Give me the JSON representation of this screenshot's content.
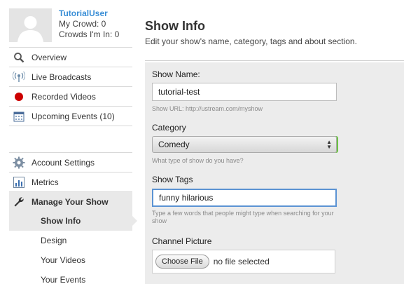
{
  "profile": {
    "username": "TutorialUser",
    "my_crowd": "My Crowd: 0",
    "crowds_in": "Crowds I'm In: 0"
  },
  "nav_top": [
    {
      "label": "Overview",
      "icon": "magnifier-icon"
    },
    {
      "label": "Live Broadcasts",
      "icon": "broadcast-icon"
    },
    {
      "label": "Recorded Videos",
      "icon": "record-icon"
    },
    {
      "label": "Upcoming Events (10)",
      "icon": "calendar-icon"
    }
  ],
  "nav_bottom": [
    {
      "label": "Account Settings",
      "icon": "gear-icon"
    },
    {
      "label": "Metrics",
      "icon": "bar-chart-icon"
    },
    {
      "label": "Manage Your Show",
      "icon": "wrench-icon"
    }
  ],
  "nav_sub": [
    "Show Info",
    "Design",
    "Your Videos",
    "Your Events"
  ],
  "main": {
    "title": "Show Info",
    "subtitle": "Edit your show's name, category, tags and about section."
  },
  "form": {
    "show_name_label": "Show Name:",
    "show_name_value": "tutorial-test",
    "show_url": "Show URL: http://ustream.com/myshow",
    "category_label": "Category",
    "category_value": "Comedy",
    "category_hint": "What type of show do you have?",
    "tags_label": "Show Tags",
    "tags_value": "funny hilarious",
    "tags_hint": "Type a few words that people might type when searching for your show",
    "picture_label": "Channel Picture",
    "choose_file": "Choose File",
    "no_file": "no file selected"
  },
  "colors": {
    "accent": "#3b8fd6",
    "record": "#cc0000",
    "focus": "#5b93d3",
    "select_edge": "#6bc243"
  }
}
